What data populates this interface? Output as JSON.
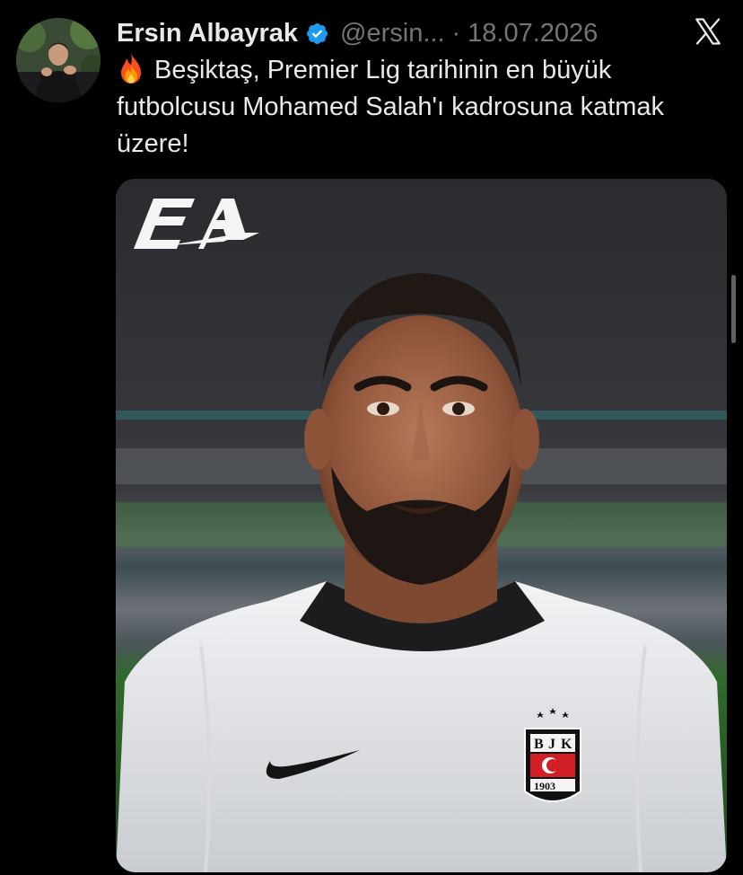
{
  "author": {
    "display_name": "Ersin Albayrak",
    "handle": "@ersin...",
    "separator": "·",
    "date": "18.07.2026",
    "verified": true
  },
  "tweet": {
    "emoji": "🔥",
    "text": "Beşiktaş, Premier Lig tarihinin en büyük futbolcusu Mohamed Salah'ı kadrosuna katmak üzere!"
  },
  "media": {
    "logo_text": "EA",
    "crest_letters": [
      "B",
      "J",
      "K"
    ],
    "crest_year": "1903"
  },
  "icons": {
    "verified": "verified-badge-icon",
    "close": "x-logo-icon",
    "emoji": "fire-icon"
  },
  "colors": {
    "background": "#000000",
    "text_primary": "#e7e9ea",
    "text_secondary": "#71767b",
    "verified_blue": "#1d9bf0"
  }
}
